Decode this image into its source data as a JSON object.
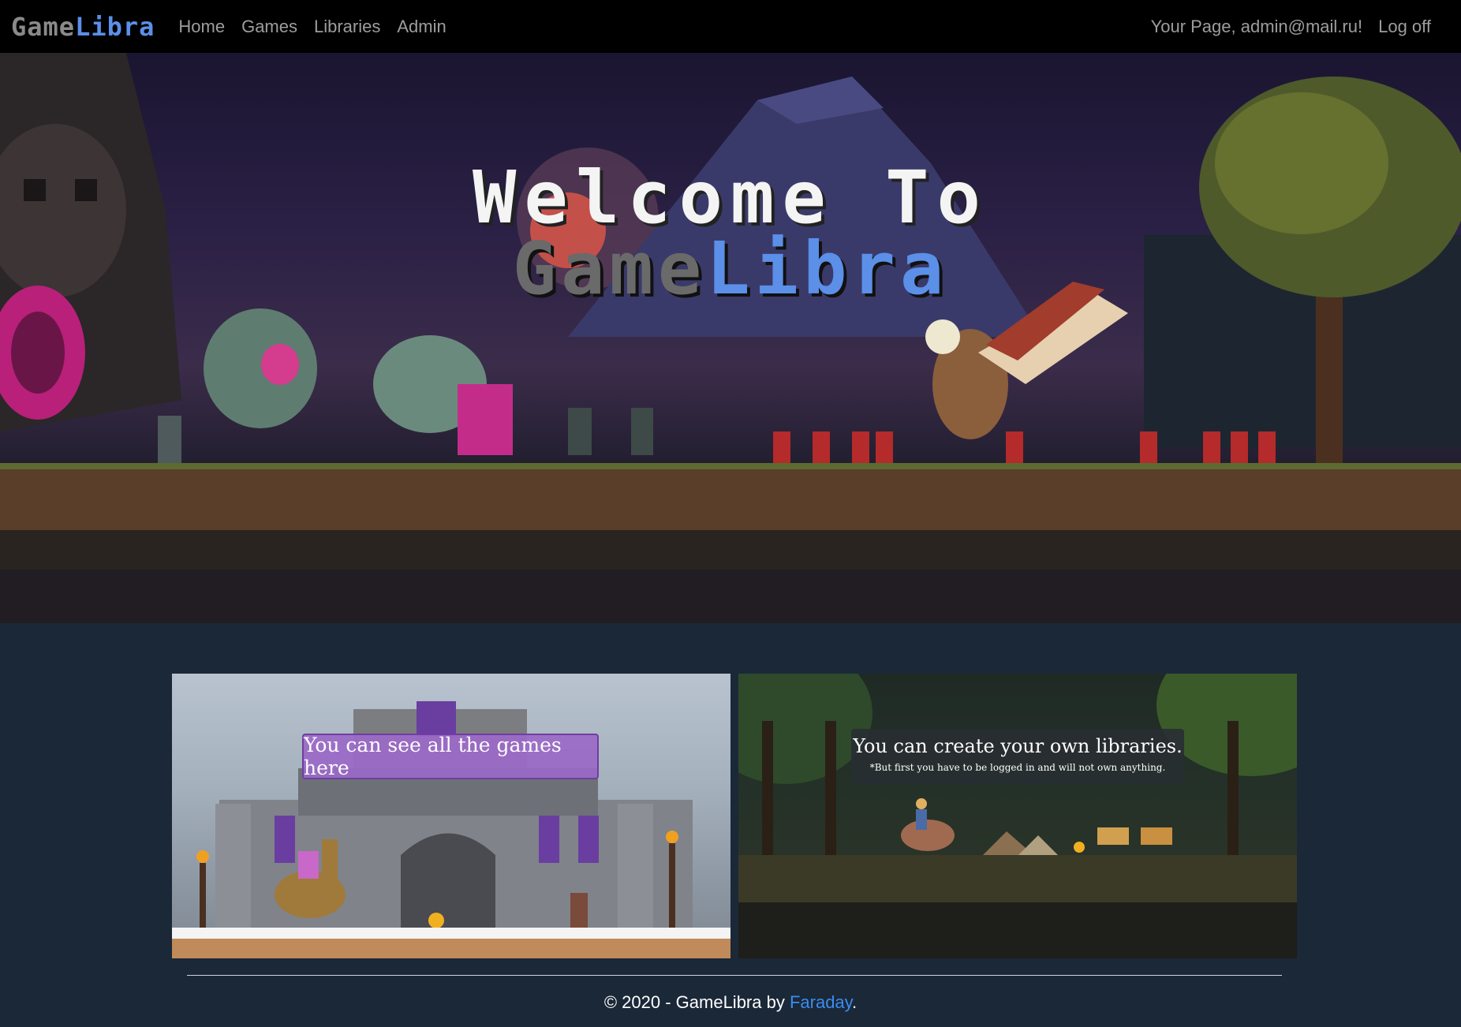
{
  "navbar": {
    "brand": {
      "part1": "Game",
      "part2": "Libra"
    },
    "links": [
      "Home",
      "Games",
      "Libraries",
      "Admin"
    ],
    "user_greeting": "Your Page, admin@mail.ru!",
    "logout": "Log off"
  },
  "hero": {
    "line1": "Welcome To",
    "line2_part1": "Game",
    "line2_part2": "Libra"
  },
  "cards": [
    {
      "caption": "You can see all the games here"
    },
    {
      "caption": "You can create your own libraries.",
      "subcaption": "*But first you have to be logged in and will not own anything."
    }
  ],
  "footer": {
    "prefix": "© 2020 - GameLibra by ",
    "author": "Faraday",
    "suffix": "."
  },
  "colors": {
    "background": "#1b2838",
    "navbar": "#000000",
    "accent_blue": "#5b8fe8",
    "link_blue": "#3b8cf0",
    "caption_purple": "#9b69c8"
  }
}
